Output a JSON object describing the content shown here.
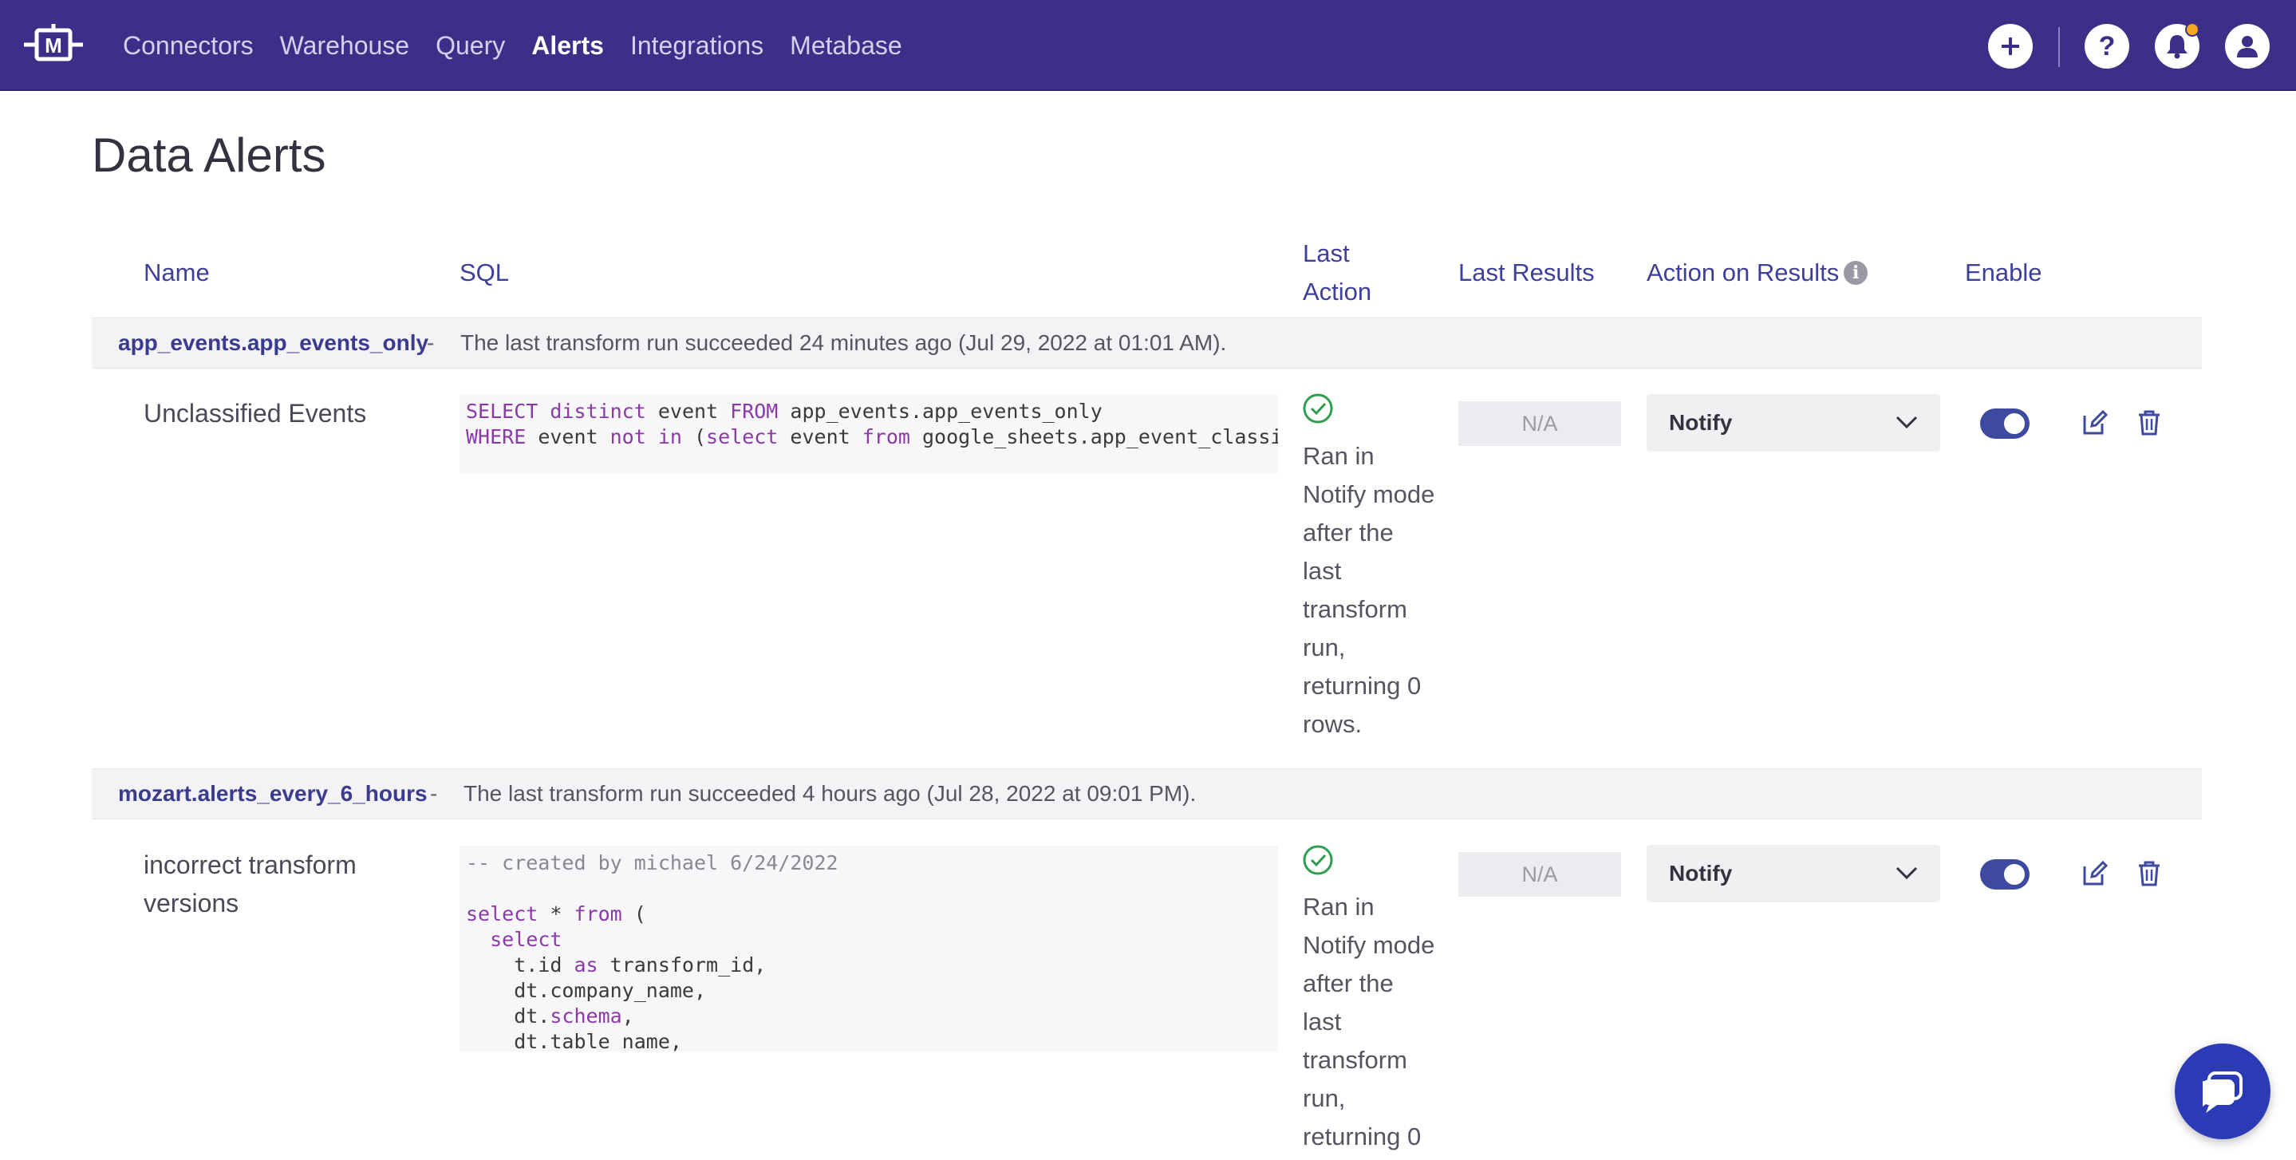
{
  "nav": {
    "logo_letter": "M",
    "items": [
      {
        "label": "Connectors",
        "active": false
      },
      {
        "label": "Warehouse",
        "active": false
      },
      {
        "label": "Query",
        "active": false
      },
      {
        "label": "Alerts",
        "active": true
      },
      {
        "label": "Integrations",
        "active": false
      },
      {
        "label": "Metabase",
        "active": false
      }
    ],
    "icons": [
      "add-icon",
      "help-icon",
      "bell-icon",
      "user-icon"
    ]
  },
  "page": {
    "title": "Data Alerts"
  },
  "table": {
    "headers": {
      "name": "Name",
      "sql": "SQL",
      "last_action": "Last Action",
      "last_results": "Last Results",
      "action_on_results": "Action on Results",
      "enable": "Enable"
    },
    "groups": [
      {
        "name": "app_events.app_events_only",
        "dash": "-",
        "status": "The last transform run succeeded 24 minutes ago (Jul 29, 2022 at 01:01 AM).",
        "alert": {
          "name": "Unclassified Events",
          "sql_lines": [
            "SELECT distinct event FROM app_events.app_events_only",
            "WHERE event not in (select event from google_sheets.app_event_classific"
          ],
          "last_action": "Ran in Notify mode after the last transform run, returning 0 rows.",
          "last_results": "N/A",
          "action": "Notify",
          "enabled": true
        }
      },
      {
        "name": "mozart.alerts_every_6_hours",
        "dash": "-",
        "status": "The last transform run succeeded 4 hours ago (Jul 28, 2022 at 09:01 PM).",
        "alert": {
          "name": "incorrect transform versions",
          "sql_lines": [
            "-- created by michael 6/24/2022",
            "",
            "select * from (",
            "  select",
            "    t.id as transform_id,",
            "    dt.company_name,",
            "    dt.schema,",
            "    dt.table_name,"
          ],
          "last_action": "Ran in Notify mode after the last transform run, returning 0",
          "last_results": "N/A",
          "action": "Notify",
          "enabled": true
        }
      }
    ]
  },
  "colors": {
    "nav_bg": "#3d2f87",
    "header_text": "#3d3f9a",
    "toggle_on": "#3d4aa0",
    "success": "#2e9d4e",
    "notification_dot": "#f5a623",
    "chat_button": "#2b3bb5"
  },
  "chat": {
    "icon": "chat-icon"
  }
}
